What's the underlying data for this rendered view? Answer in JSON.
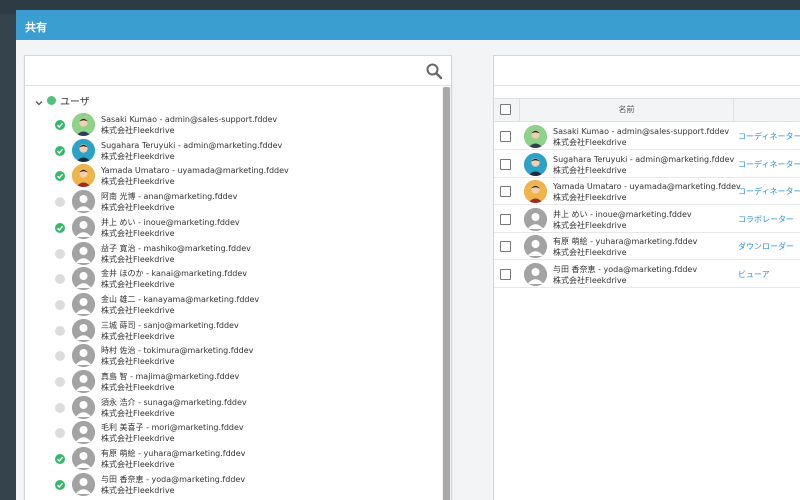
{
  "dialog": {
    "title": "共有"
  },
  "search": {
    "value": "",
    "placeholder": ""
  },
  "tree": {
    "group_label": "ユーザ",
    "users": [
      {
        "name": "Sasaki Kumao - admin@sales-support.fddev",
        "org": "株式会社Fleekdrive",
        "checked": true,
        "avatar": "photo-green"
      },
      {
        "name": "Sugahara Teruyuki - admin@marketing.fddev",
        "org": "株式会社Fleekdrive",
        "checked": true,
        "avatar": "photo-teal"
      },
      {
        "name": "Yamada Umataro - uyamada@marketing.fddev",
        "org": "株式会社Fleekdrive",
        "checked": true,
        "avatar": "photo-orange"
      },
      {
        "name": "阿南 光博 - anan@marketing.fddev",
        "org": "株式会社Fleekdrive",
        "checked": false,
        "avatar": "default"
      },
      {
        "name": "井上 めい - inoue@marketing.fddev",
        "org": "株式会社Fleekdrive",
        "checked": true,
        "avatar": "default"
      },
      {
        "name": "益子 寛治 - mashiko@marketing.fddev",
        "org": "株式会社Fleekdrive",
        "checked": false,
        "avatar": "default"
      },
      {
        "name": "金井 ほのか - kanai@marketing.fddev",
        "org": "株式会社Fleekdrive",
        "checked": false,
        "avatar": "default"
      },
      {
        "name": "金山 雄二 - kanayama@marketing.fddev",
        "org": "株式会社Fleekdrive",
        "checked": false,
        "avatar": "default"
      },
      {
        "name": "三城 蒔司 - sanjo@marketing.fddev",
        "org": "株式会社Fleekdrive",
        "checked": false,
        "avatar": "default"
      },
      {
        "name": "時村 佐治 - tokimura@marketing.fddev",
        "org": "株式会社Fleekdrive",
        "checked": false,
        "avatar": "default"
      },
      {
        "name": "真島 智 - majima@marketing.fddev",
        "org": "株式会社Fleekdrive",
        "checked": false,
        "avatar": "default"
      },
      {
        "name": "須永 浩介 - sunaga@marketing.fddev",
        "org": "株式会社Fleekdrive",
        "checked": false,
        "avatar": "default"
      },
      {
        "name": "毛利 美喜子 - mori@marketing.fddev",
        "org": "株式会社Fleekdrive",
        "checked": false,
        "avatar": "default"
      },
      {
        "name": "有原 萌絵 - yuhara@marketing.fddev",
        "org": "株式会社Fleekdrive",
        "checked": true,
        "avatar": "default"
      },
      {
        "name": "与田 香奈恵 - yoda@marketing.fddev",
        "org": "株式会社Fleekdrive",
        "checked": true,
        "avatar": "default"
      }
    ]
  },
  "shared": {
    "column_name": "名前",
    "rows": [
      {
        "name": "Sasaki Kumao - admin@sales-support.fddev",
        "org": "株式会社Fleekdrive",
        "role": "コーディネーター",
        "avatar": "photo-green"
      },
      {
        "name": "Sugahara Teruyuki - admin@marketing.fddev",
        "org": "株式会社Fleekdrive",
        "role": "コーディネーター",
        "avatar": "photo-teal"
      },
      {
        "name": "Yamada Umataro - uyamada@marketing.fddev",
        "org": "株式会社Fleekdrive",
        "role": "コーディネーター",
        "avatar": "photo-orange"
      },
      {
        "name": "井上 めい - inoue@marketing.fddev",
        "org": "株式会社Fleekdrive",
        "role": "コラボレーター",
        "avatar": "default"
      },
      {
        "name": "有原 萌絵 - yuhara@marketing.fddev",
        "org": "株式会社Fleekdrive",
        "role": "ダウンローダー",
        "avatar": "default"
      },
      {
        "name": "与田 香奈恵 - yoda@marketing.fddev",
        "org": "株式会社Fleekdrive",
        "role": "ビューア",
        "avatar": "default"
      }
    ]
  },
  "colors": {
    "header": "#3a9fd0",
    "check": "#35b86a",
    "link": "#2e90d6",
    "group_dot": "#4cc27a"
  }
}
